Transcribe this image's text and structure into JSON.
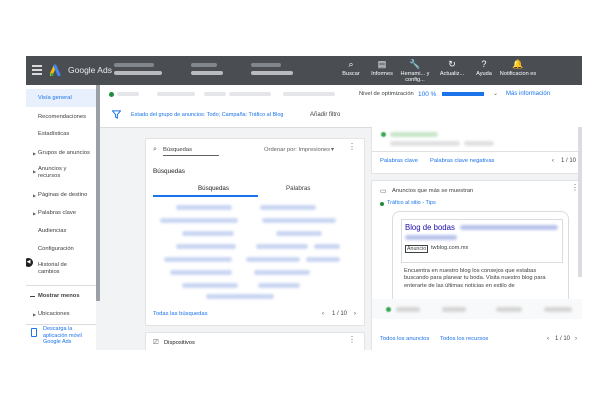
{
  "topbar": {
    "brand": "Google Ads",
    "buttons": [
      {
        "label": "Buscar",
        "icon": "search-icon"
      },
      {
        "label": "Informes",
        "icon": "reports-icon"
      },
      {
        "label": "Herrami... y config...",
        "icon": "tools-icon"
      },
      {
        "label": "Actualiz...",
        "icon": "refresh-icon"
      },
      {
        "label": "Ayuda",
        "icon": "help-icon"
      },
      {
        "label": "Notificacion es",
        "icon": "bell-icon"
      }
    ]
  },
  "sidebar": {
    "items": [
      {
        "label": "Visía general",
        "active": true,
        "arrow": false
      },
      {
        "label": "Recomendaciones",
        "active": false,
        "arrow": false
      },
      {
        "label": "Estadísticas",
        "active": false,
        "arrow": false
      },
      {
        "label": "Grupos de anuncios",
        "active": false,
        "arrow": true
      },
      {
        "label": "Anuncios y recursos",
        "active": false,
        "arrow": true
      },
      {
        "label": "Páginas de destino",
        "active": false,
        "arrow": true
      },
      {
        "label": "Palabras clave",
        "active": false,
        "arrow": true
      },
      {
        "label": "Audiencias",
        "active": false,
        "arrow": false
      },
      {
        "label": "Configuración",
        "active": false,
        "arrow": false
      },
      {
        "label": "Historial de cambios",
        "active": false,
        "arrow": false
      }
    ],
    "show_less": "Mostrar menos",
    "ubicaciones": "Ubicaciones",
    "download": "Descarga la aplicación móvil Google Ads"
  },
  "status": {
    "optimization_label": "Nivel de optimización",
    "optimization_value": "100 %",
    "optimization_fraction": 1.0,
    "more_info": "Más información"
  },
  "filter": {
    "text": "Estado del grupo de anuncios: Todo; Campaña: Tráfico al Blog",
    "add": "Añadir filtro"
  },
  "search_card": {
    "search_placeholder": "Búsquedas",
    "sort_label": "Ordenar por: Impresiones",
    "title": "Búsquedas",
    "col_searches": "Búsquedas",
    "col_words": "Palabras",
    "footer_link": "Todas las búsquedas",
    "pager": "1 / 10"
  },
  "keywords_card": {
    "link1": "Palabras clave",
    "link2": "Palabras clave negativas",
    "pager": "1 / 10"
  },
  "ads_card": {
    "title": "Anuncios que más se muestran",
    "campaign": "Tráfico al sitio - Tips",
    "ad_headline": "Blog de bodas",
    "ad_badge": "Anuncio",
    "ad_url": "twblog.com.mx",
    "ad_description": "Encuentra en nuestro blog los consejos que estabas buscando para planear tu boda. Visita nuestro blog para enterarte de las últimas noticias en estilo de",
    "footer_link1": "Todos los anuncios",
    "footer_link2": "Todos los recursos",
    "pager": "1 / 10"
  },
  "devices_card": {
    "title": "Dispositivos"
  }
}
